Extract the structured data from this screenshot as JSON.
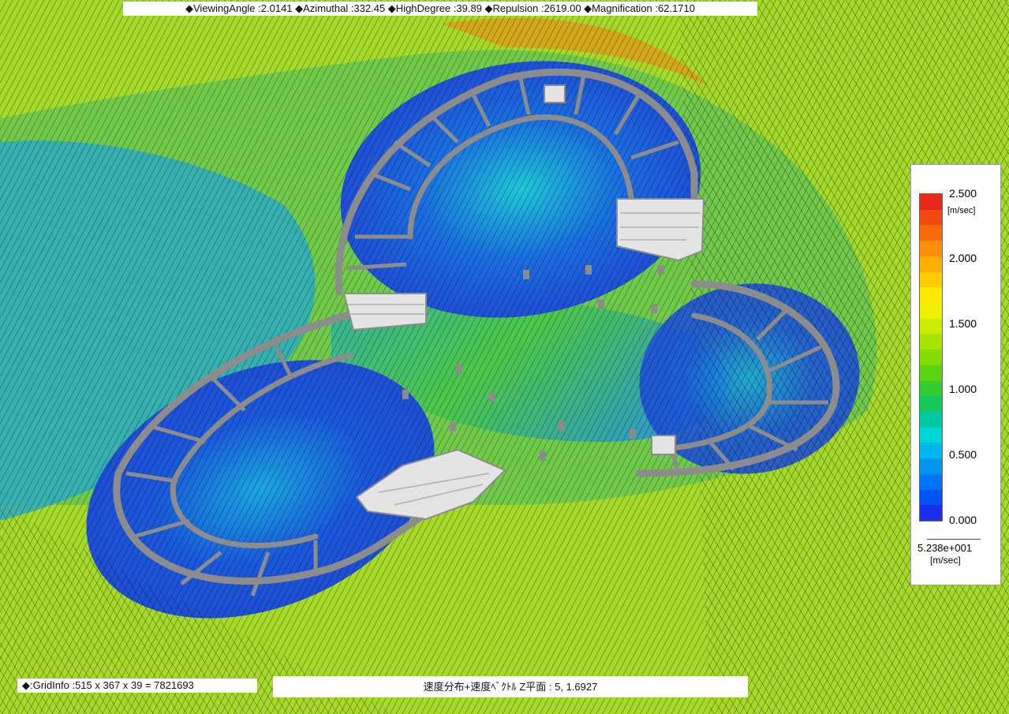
{
  "header": {
    "info_text": "◆ViewingAngle :2.0141  ◆Azimuthal :332.45 ◆HighDegree :39.89  ◆Repulsion :2619.00  ◆Magnification :62.1710"
  },
  "footer": {
    "grid_info": "◆:GridInfo :515 x 367 x 39 = 7821693",
    "plane_info": "速度分布+速度ﾍﾞｸﾄﾙ Z平面 : 5,  1.6927"
  },
  "legend": {
    "max_label": "2.500",
    "unit_label": "[m/sec]",
    "ticks": [
      "2.000",
      "1.500",
      "1.000",
      "0.500",
      "0.000"
    ],
    "ref_value": "5.238e+001",
    "ref_unit": "[m/sec]",
    "colors": [
      "#e8281a",
      "#f04a12",
      "#f76a0c",
      "#fb8f08",
      "#ffae00",
      "#ffcc00",
      "#ffe800",
      "#f0f000",
      "#ccec00",
      "#a8e400",
      "#84dc00",
      "#5cd412",
      "#33cc33",
      "#16c85a",
      "#00c8a0",
      "#00d6d6",
      "#00b8ec",
      "#0096f0",
      "#0074f2",
      "#0052f2",
      "#1a30ee"
    ]
  },
  "scene": {
    "background_color": "#a6d92a",
    "wall_color": "#8c8c8c",
    "roof_color": "#e4e4e4",
    "calm_color": "#1f4fd6",
    "icons": {
      "viewport": "cfd-velocity-field",
      "buildings": "building-block-icon"
    }
  }
}
